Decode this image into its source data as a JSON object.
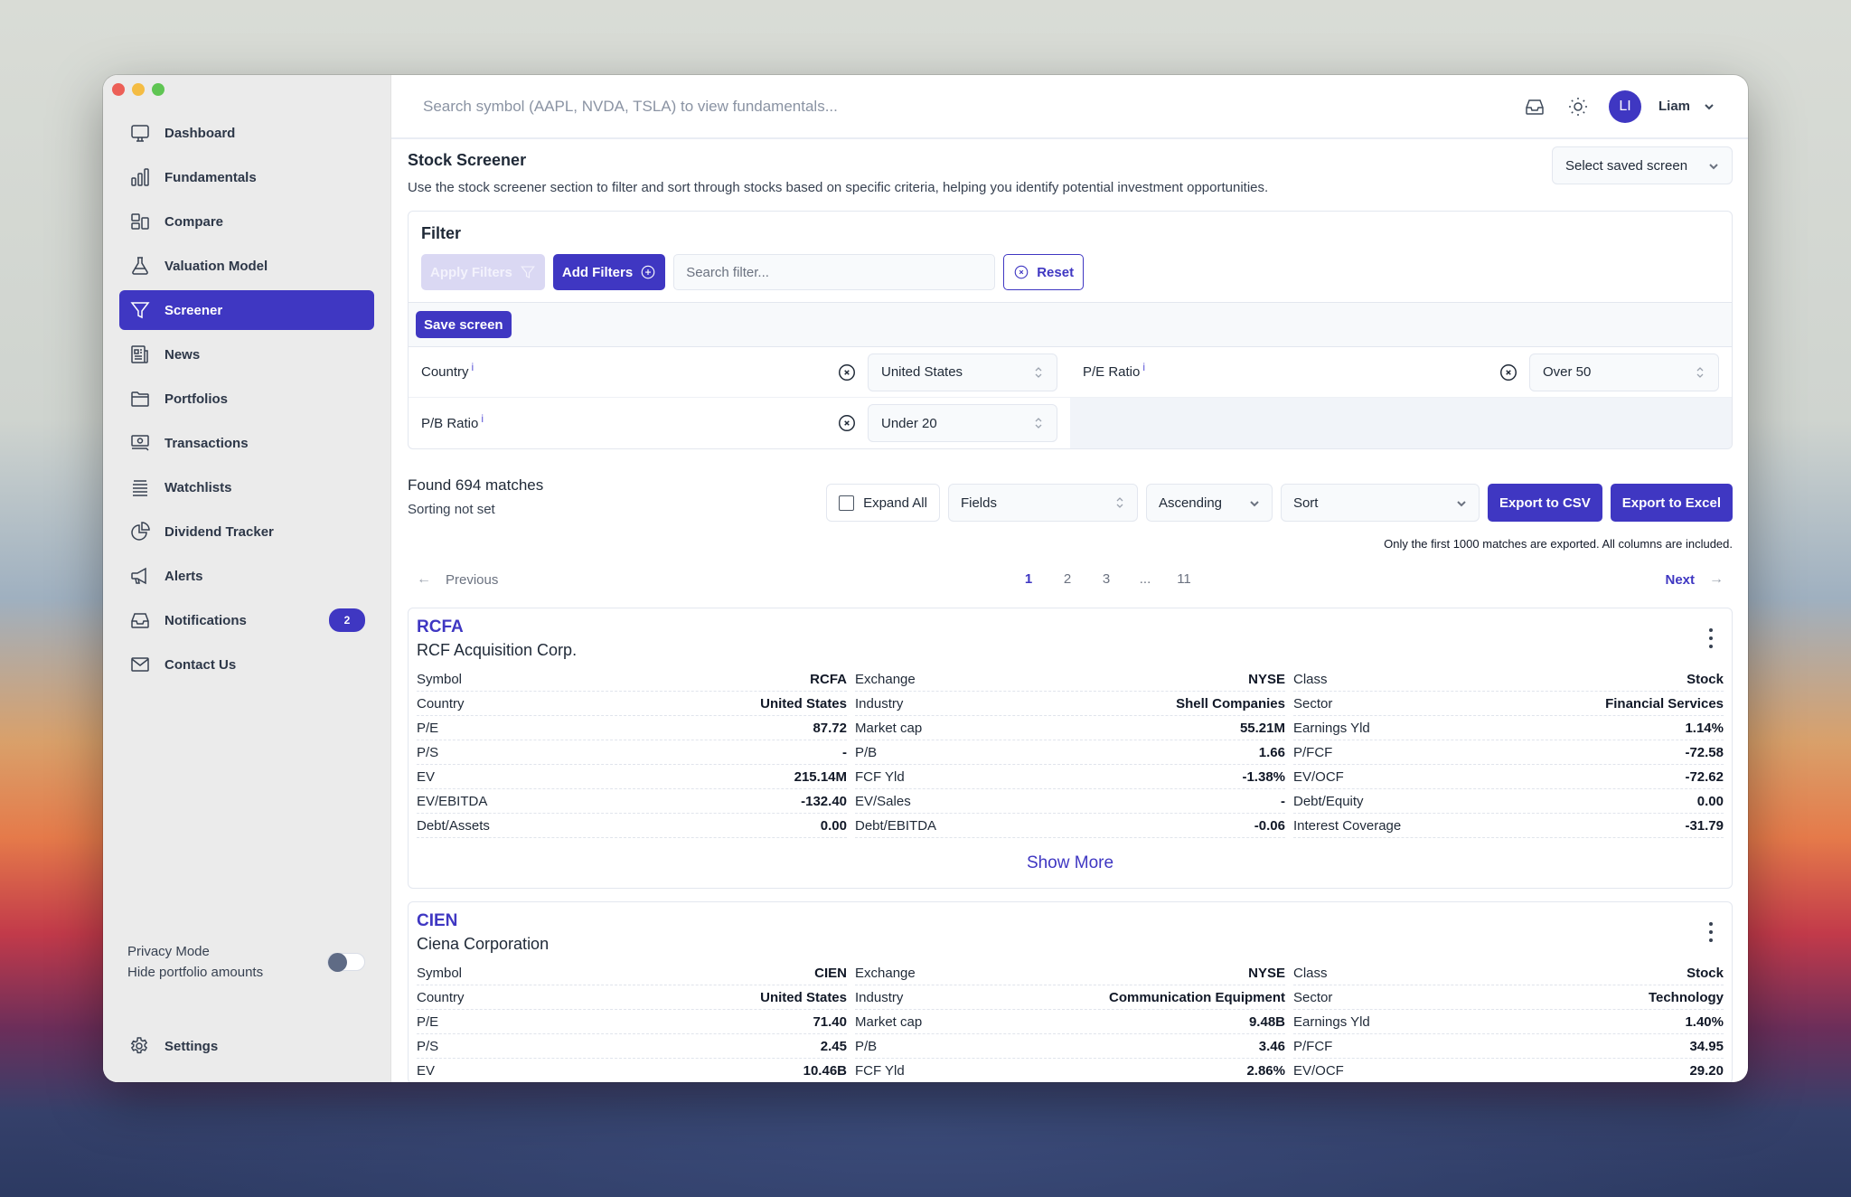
{
  "window": {
    "traffic_lights": [
      "close",
      "minimize",
      "zoom"
    ]
  },
  "sidebar": {
    "items": [
      {
        "label": "Dashboard",
        "icon": "monitor-icon",
        "active": false
      },
      {
        "label": "Fundamentals",
        "icon": "bar-chart-icon",
        "active": false
      },
      {
        "label": "Compare",
        "icon": "compare-layout-icon",
        "active": false
      },
      {
        "label": "Valuation Model",
        "icon": "flask-icon",
        "active": false
      },
      {
        "label": "Screener",
        "icon": "filter-funnel-icon",
        "active": true
      },
      {
        "label": "News",
        "icon": "newspaper-icon",
        "active": false
      },
      {
        "label": "Portfolios",
        "icon": "folder-icon",
        "active": false
      },
      {
        "label": "Transactions",
        "icon": "cash-icon",
        "active": false
      },
      {
        "label": "Watchlists",
        "icon": "list-icon",
        "active": false
      },
      {
        "label": "Dividend Tracker",
        "icon": "pie-chart-icon",
        "active": false
      },
      {
        "label": "Alerts",
        "icon": "megaphone-icon",
        "active": false
      },
      {
        "label": "Notifications",
        "icon": "inbox-icon",
        "active": false,
        "badge": "2"
      },
      {
        "label": "Contact Us",
        "icon": "envelope-icon",
        "active": false
      }
    ],
    "privacy": {
      "title": "Privacy Mode",
      "subtitle": "Hide portfolio amounts",
      "enabled": false
    },
    "settings_label": "Settings"
  },
  "topbar": {
    "search_placeholder": "Search symbol (AAPL, NVDA, TSLA) to view fundamentals...",
    "avatar_initials": "LI",
    "user_name": "Liam"
  },
  "page": {
    "title": "Stock Screener",
    "description": "Use the stock screener section to filter and sort through stocks based on specific criteria, helping you identify potential investment opportunities.",
    "saved_screen_placeholder": "Select saved screen"
  },
  "filter": {
    "title": "Filter",
    "apply_label": "Apply Filters",
    "add_label": "Add Filters",
    "search_placeholder": "Search filter...",
    "reset_label": "Reset",
    "save_label": "Save screen",
    "info_glyph": "i",
    "criteria": [
      {
        "label": "Country",
        "value": "United States"
      },
      {
        "label": "P/E Ratio",
        "value": "Over 50"
      },
      {
        "label": "P/B Ratio",
        "value": "Under 20"
      }
    ]
  },
  "results": {
    "found_text": "Found 694 matches",
    "sorting_text": "Sorting not set",
    "expand_all_label": "Expand All",
    "expand_all_checked": false,
    "fields_label": "Fields",
    "order_label": "Ascending",
    "sort_label": "Sort",
    "export_csv_label": "Export to CSV",
    "export_excel_label": "Export to Excel",
    "export_note": "Only the first 1000 matches are exported. All columns are included."
  },
  "pagination": {
    "prev_label": "Previous",
    "next_label": "Next",
    "pages": [
      "1",
      "2",
      "3",
      "...",
      "11"
    ],
    "current": "1"
  },
  "cards": [
    {
      "ticker": "RCFA",
      "name": "RCF Acquisition Corp.",
      "columns": [
        [
          {
            "k": "Symbol",
            "v": "RCFA"
          },
          {
            "k": "Country",
            "v": "United States"
          },
          {
            "k": "P/E",
            "v": "87.72"
          },
          {
            "k": "P/S",
            "v": "-"
          },
          {
            "k": "EV",
            "v": "215.14M"
          },
          {
            "k": "EV/EBITDA",
            "v": "-132.40"
          },
          {
            "k": "Debt/Assets",
            "v": "0.00"
          }
        ],
        [
          {
            "k": "Exchange",
            "v": "NYSE"
          },
          {
            "k": "Industry",
            "v": "Shell Companies"
          },
          {
            "k": "Market cap",
            "v": "55.21M"
          },
          {
            "k": "P/B",
            "v": "1.66"
          },
          {
            "k": "FCF Yld",
            "v": "-1.38%"
          },
          {
            "k": "EV/Sales",
            "v": "-"
          },
          {
            "k": "Debt/EBITDA",
            "v": "-0.06"
          }
        ],
        [
          {
            "k": "Class",
            "v": "Stock"
          },
          {
            "k": "Sector",
            "v": "Financial Services"
          },
          {
            "k": "Earnings Yld",
            "v": "1.14%"
          },
          {
            "k": "P/FCF",
            "v": "-72.58"
          },
          {
            "k": "EV/OCF",
            "v": "-72.62"
          },
          {
            "k": "Debt/Equity",
            "v": "0.00"
          },
          {
            "k": "Interest Coverage",
            "v": "-31.79"
          }
        ]
      ],
      "show_more_label": "Show More"
    },
    {
      "ticker": "CIEN",
      "name": "Ciena Corporation",
      "columns": [
        [
          {
            "k": "Symbol",
            "v": "CIEN"
          },
          {
            "k": "Country",
            "v": "United States"
          },
          {
            "k": "P/E",
            "v": "71.40"
          },
          {
            "k": "P/S",
            "v": "2.45"
          },
          {
            "k": "EV",
            "v": "10.46B"
          }
        ],
        [
          {
            "k": "Exchange",
            "v": "NYSE"
          },
          {
            "k": "Industry",
            "v": "Communication Equipment"
          },
          {
            "k": "Market cap",
            "v": "9.48B"
          },
          {
            "k": "P/B",
            "v": "3.46"
          },
          {
            "k": "FCF Yld",
            "v": "2.86%"
          }
        ],
        [
          {
            "k": "Class",
            "v": "Stock"
          },
          {
            "k": "Sector",
            "v": "Technology"
          },
          {
            "k": "Earnings Yld",
            "v": "1.40%"
          },
          {
            "k": "P/FCF",
            "v": "34.95"
          },
          {
            "k": "EV/OCF",
            "v": "29.20"
          }
        ]
      ]
    }
  ],
  "colors": {
    "accent": "#3f37c2",
    "accent_disabled": "#dad8f3",
    "sidebar_bg": "#ebebeb"
  }
}
